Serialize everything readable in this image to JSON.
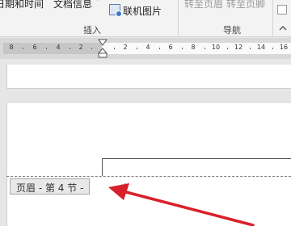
{
  "ribbon": {
    "date_time_label": "日期和时间",
    "doc_info_label": "文档信息",
    "online_picture_label": "联机图片",
    "goto_header_label": "转至页眉",
    "goto_footer_label": "转至页脚",
    "insert_group_label": "插入",
    "navigation_group_label": "导航"
  },
  "ruler": {
    "labels_left": [
      "8",
      "6",
      "4",
      "2"
    ],
    "labels_right": [
      "2",
      "4",
      "6",
      "8",
      "10",
      "12",
      "14",
      "16"
    ]
  },
  "document": {
    "header_tag": "页眉 - 第 4 节 -",
    "para_mark": "↵"
  },
  "colors": {
    "arrow": "#d9202a",
    "ribbon_bg": "#f3f3f3",
    "workspace": "#e6e6e6"
  }
}
